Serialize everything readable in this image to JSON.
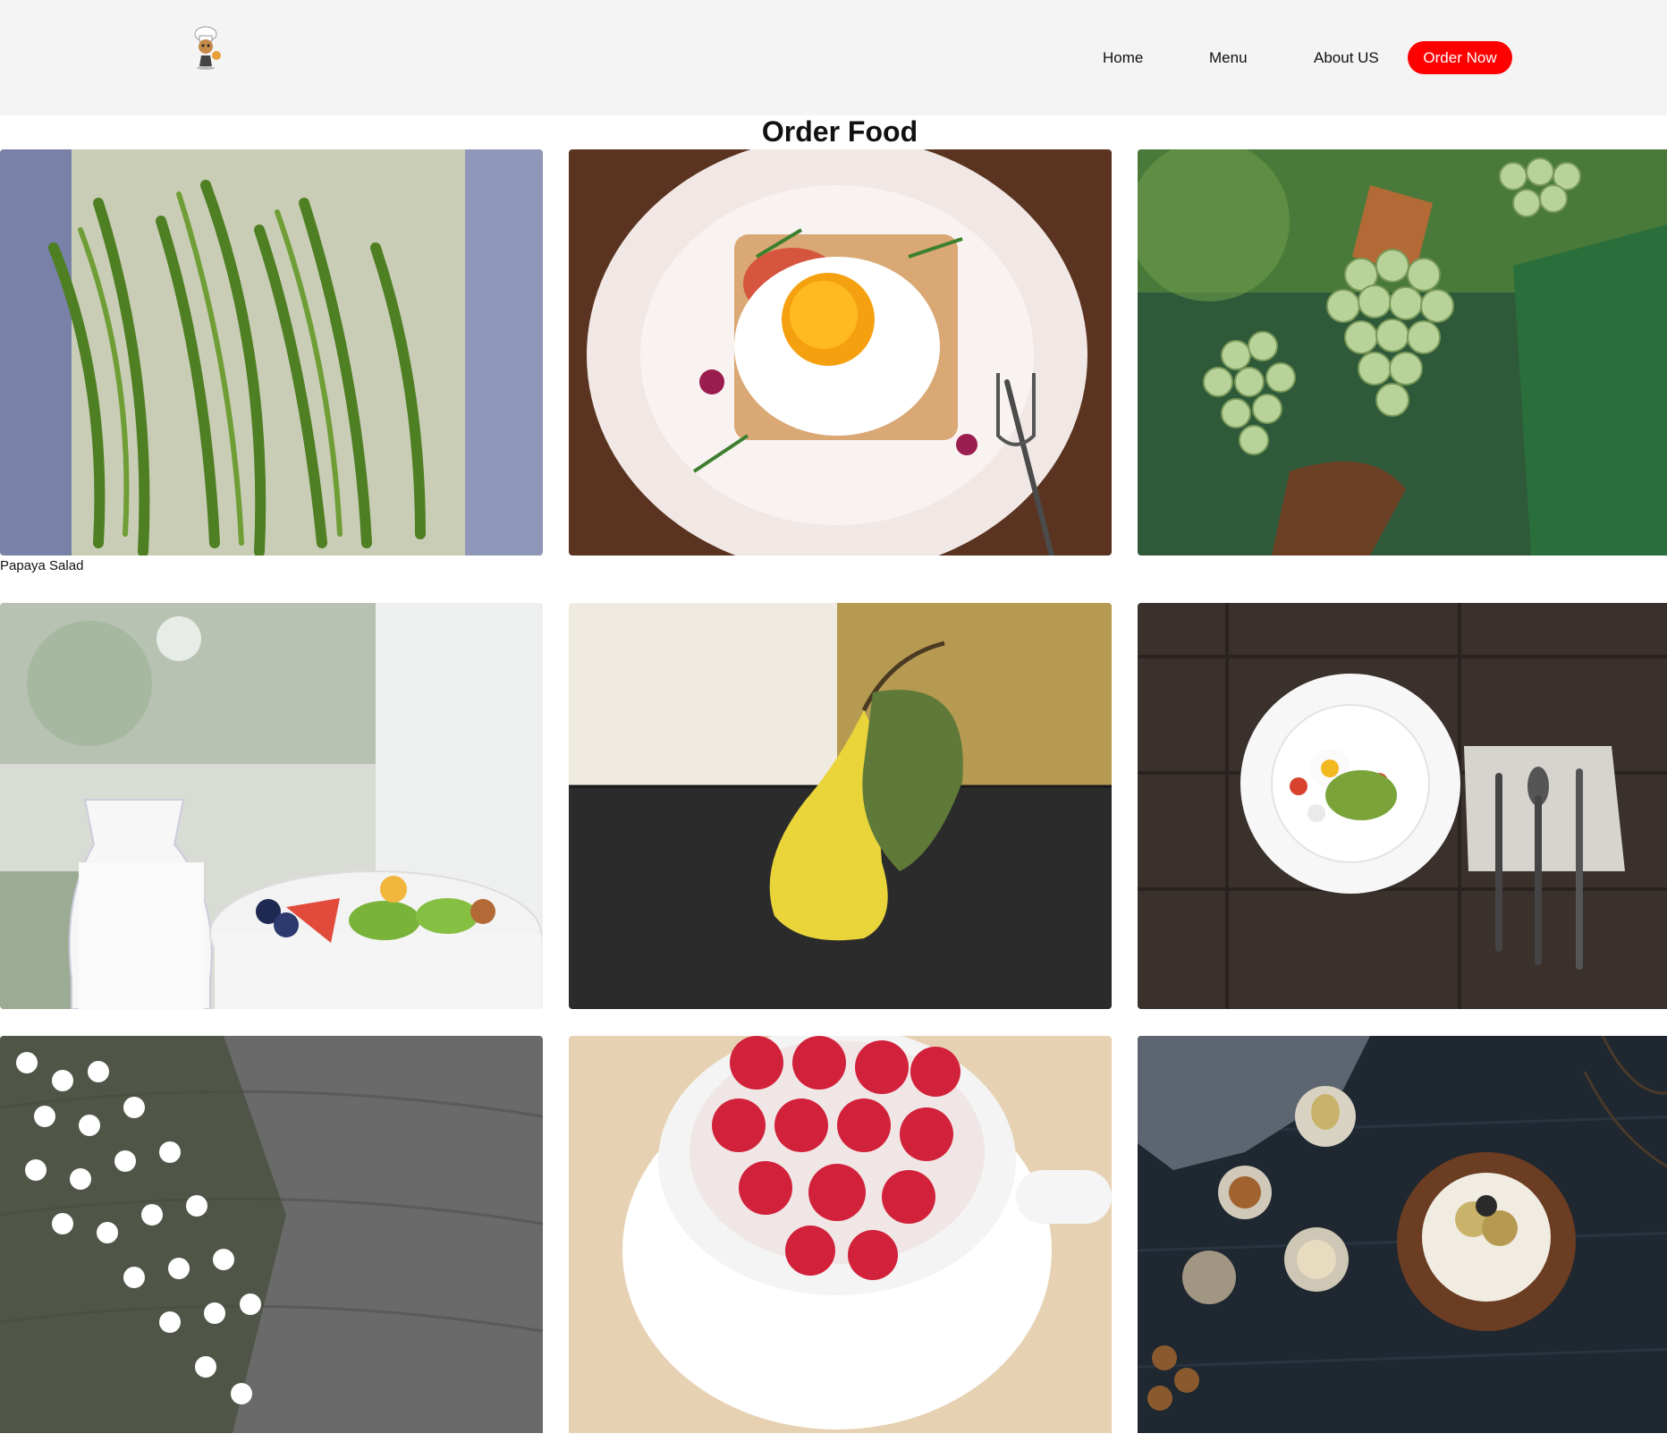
{
  "header": {
    "logo": "chef-mascot-logo",
    "nav": [
      {
        "label": "Home"
      },
      {
        "label": "Menu"
      },
      {
        "label": "About US"
      }
    ],
    "cta_label": "Order Now",
    "cta_color": "#ff0000"
  },
  "page": {
    "title": "Order Food"
  },
  "gallery": {
    "items": [
      {
        "image": "green-beans-photo",
        "caption": "Papaya Salad"
      },
      {
        "image": "egg-toast-plate-photo"
      },
      {
        "image": "grape-vine-photo"
      },
      {
        "image": "milk-fruit-bowl-photo"
      },
      {
        "image": "yellow-pear-photo"
      },
      {
        "image": "salad-plate-cutlery-photo"
      },
      {
        "image": "white-flowers-wood-photo"
      },
      {
        "image": "raspberries-cup-photo"
      },
      {
        "image": "dessert-dark-table-photo"
      }
    ]
  }
}
